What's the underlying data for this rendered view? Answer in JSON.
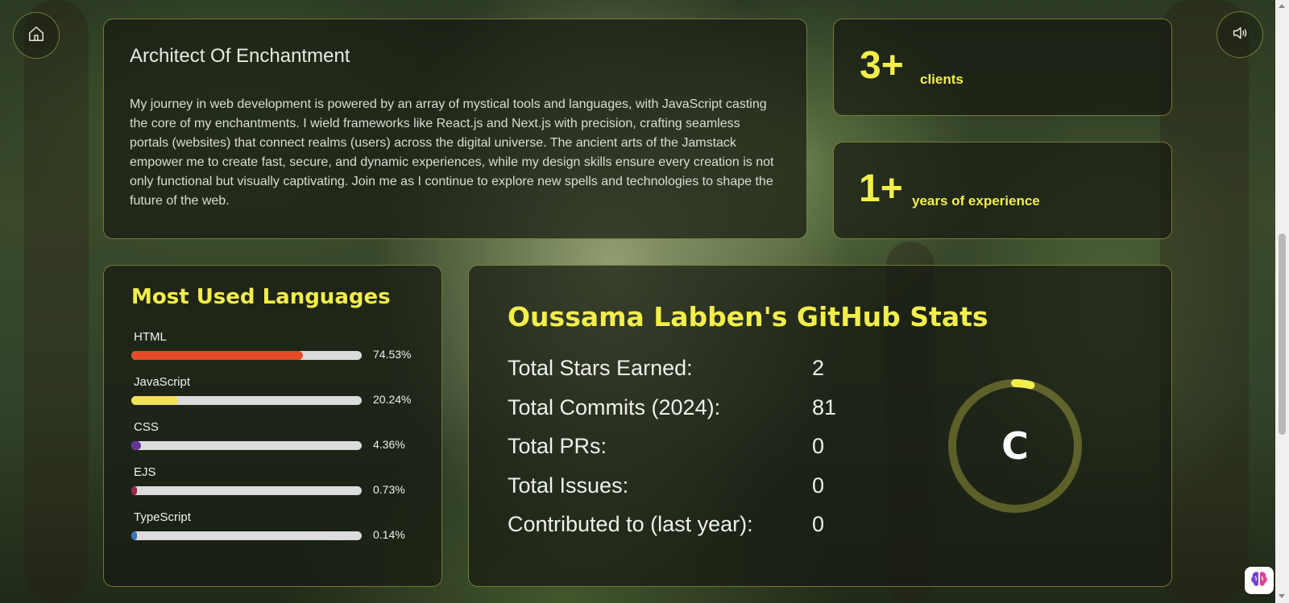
{
  "nav": {
    "home_icon": "home-icon",
    "sound_icon": "speaker-icon"
  },
  "about": {
    "title": "Architect Of Enchantment",
    "text": "My journey in web development is powered by an array of mystical tools and languages, with JavaScript casting the core of my enchantments. I wield frameworks like React.js and Next.js with precision, crafting seamless portals (websites) that connect realms (users) across the digital universe. The ancient arts of the Jamstack empower me to create fast, secure, and dynamic experiences, while my design skills ensure every creation is not only functional but visually captivating. Join me as I continue to explore new spells and technologies to shape the future of the web."
  },
  "stats": {
    "clients": {
      "value": "3+",
      "label": "clients"
    },
    "experience": {
      "value": "1+",
      "label": "years of experience"
    }
  },
  "languages": {
    "title": "Most Used Languages",
    "items": [
      {
        "name": "HTML",
        "percent_label": "74.53%",
        "percent": 74.53,
        "color": "#e34c26"
      },
      {
        "name": "JavaScript",
        "percent_label": "20.24%",
        "percent": 20.24,
        "color": "#f1e05a"
      },
      {
        "name": "CSS",
        "percent_label": "4.36%",
        "percent": 4.36,
        "color": "#663399"
      },
      {
        "name": "EJS",
        "percent_label": "0.73%",
        "percent": 0.73,
        "color": "#a91e50"
      },
      {
        "name": "TypeScript",
        "percent_label": "0.14%",
        "percent": 0.14,
        "color": "#3178c6"
      }
    ]
  },
  "github": {
    "title": "Oussama Labben's GitHub Stats",
    "rows": [
      {
        "label": "Total Stars Earned:",
        "value": "2"
      },
      {
        "label": "Total Commits (2024):",
        "value": "81"
      },
      {
        "label": "Total PRs:",
        "value": "0"
      },
      {
        "label": "Total Issues:",
        "value": "0"
      },
      {
        "label": "Contributed to (last year):",
        "value": "0"
      }
    ],
    "rank": {
      "letter": "C",
      "progress_fraction": 0.04
    }
  },
  "colors": {
    "accent": "#f3ee4c",
    "panel_border": "#bebe50"
  }
}
